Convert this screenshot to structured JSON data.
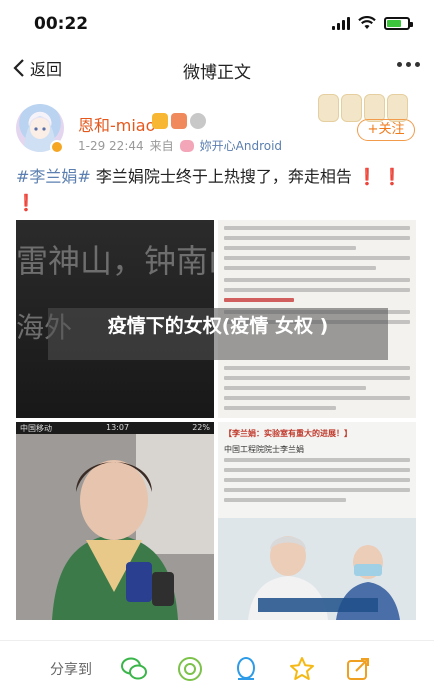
{
  "status": {
    "time": "00:22"
  },
  "nav": {
    "back_label": "返回",
    "title": "微博正文"
  },
  "author": {
    "name": "恩和-miao",
    "timestamp": "1-29 22:44",
    "source_prefix": "来自",
    "source": "妳开心Android"
  },
  "follow": {
    "label": "+关注"
  },
  "post": {
    "topic": "#李兰娟#",
    "text": " 李兰娟院士终于上热搜了，奔走相告",
    "exclaim1": "❗",
    "exclaim2": "❗",
    "exclaim3": "❗"
  },
  "images": {
    "dark_lines": [
      "雷神山，钟南山，",
      "海外"
    ],
    "person_status": {
      "left": "中国移动",
      "time": "13:07",
      "battery": "22%"
    },
    "news_caption": "【李兰娟：实验室有重大的进展！】",
    "news_subtitle": "中国工程院院士李兰娟"
  },
  "overlay": {
    "text": "疫情下的女权(疫情 女权 )"
  },
  "share": {
    "label": "分享到"
  },
  "colors": {
    "accent": "#f07a1a",
    "link": "#5b7fb0",
    "name": "#e5581c"
  }
}
